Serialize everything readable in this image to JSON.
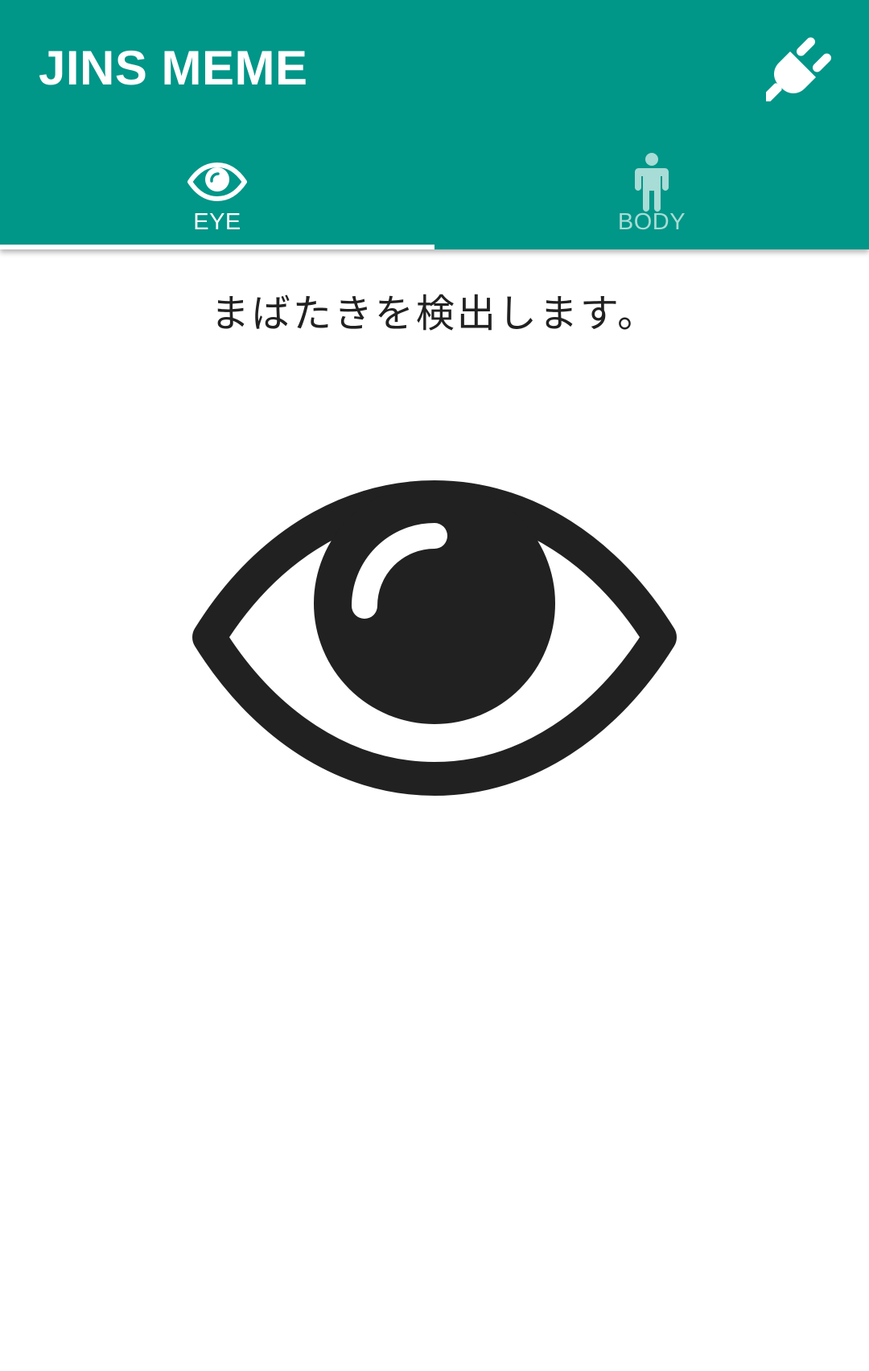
{
  "app": {
    "title": "JINS MEME",
    "accent_color": "#009688",
    "action_icon": "power-plug-icon"
  },
  "tabs": [
    {
      "label": "EYE",
      "icon": "eye-icon",
      "selected": true
    },
    {
      "label": "BODY",
      "icon": "human-figure-icon",
      "selected": false
    }
  ],
  "content": {
    "description": "まばたきを検出します。",
    "illustration": "eye-icon"
  }
}
